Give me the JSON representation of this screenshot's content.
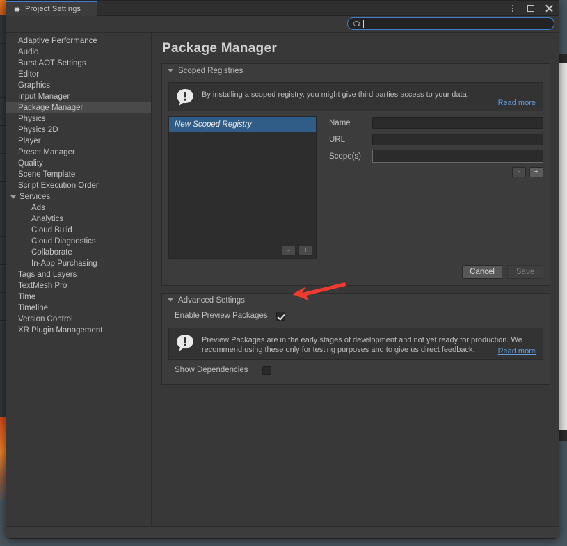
{
  "window": {
    "tab_label": "Project Settings",
    "tab_icon": "gear-icon",
    "controls": {
      "menu": "more-options-icon",
      "maximize": "maximize-icon",
      "close": "close-icon"
    },
    "accent_color": "#3f7fd0"
  },
  "search": {
    "value": "",
    "placeholder": "",
    "icon": "search-icon"
  },
  "sidebar": {
    "items": [
      {
        "label": "Adaptive Performance",
        "level": 0,
        "selected": false,
        "group": false
      },
      {
        "label": "Audio",
        "level": 0,
        "selected": false,
        "group": false
      },
      {
        "label": "Burst AOT Settings",
        "level": 0,
        "selected": false,
        "group": false
      },
      {
        "label": "Editor",
        "level": 0,
        "selected": false,
        "group": false
      },
      {
        "label": "Graphics",
        "level": 0,
        "selected": false,
        "group": false
      },
      {
        "label": "Input Manager",
        "level": 0,
        "selected": false,
        "group": false
      },
      {
        "label": "Package Manager",
        "level": 0,
        "selected": true,
        "group": false
      },
      {
        "label": "Physics",
        "level": 0,
        "selected": false,
        "group": false
      },
      {
        "label": "Physics 2D",
        "level": 0,
        "selected": false,
        "group": false
      },
      {
        "label": "Player",
        "level": 0,
        "selected": false,
        "group": false
      },
      {
        "label": "Preset Manager",
        "level": 0,
        "selected": false,
        "group": false
      },
      {
        "label": "Quality",
        "level": 0,
        "selected": false,
        "group": false
      },
      {
        "label": "Scene Template",
        "level": 0,
        "selected": false,
        "group": false
      },
      {
        "label": "Script Execution Order",
        "level": 0,
        "selected": false,
        "group": false
      },
      {
        "label": "Services",
        "level": 0,
        "selected": false,
        "group": true,
        "expanded": true
      },
      {
        "label": "Ads",
        "level": 1,
        "selected": false,
        "group": false
      },
      {
        "label": "Analytics",
        "level": 1,
        "selected": false,
        "group": false
      },
      {
        "label": "Cloud Build",
        "level": 1,
        "selected": false,
        "group": false
      },
      {
        "label": "Cloud Diagnostics",
        "level": 1,
        "selected": false,
        "group": false
      },
      {
        "label": "Collaborate",
        "level": 1,
        "selected": false,
        "group": false
      },
      {
        "label": "In-App Purchasing",
        "level": 1,
        "selected": false,
        "group": false
      },
      {
        "label": "Tags and Layers",
        "level": 0,
        "selected": false,
        "group": false
      },
      {
        "label": "TextMesh Pro",
        "level": 0,
        "selected": false,
        "group": false
      },
      {
        "label": "Time",
        "level": 0,
        "selected": false,
        "group": false
      },
      {
        "label": "Timeline",
        "level": 0,
        "selected": false,
        "group": false
      },
      {
        "label": "Version Control",
        "level": 0,
        "selected": false,
        "group": false
      },
      {
        "label": "XR Plugin Management",
        "level": 0,
        "selected": false,
        "group": false
      }
    ]
  },
  "main": {
    "title": "Package Manager",
    "scoped_registries": {
      "header": "Scoped Registries",
      "expanded": true,
      "notice": {
        "icon": "info-bubble-icon",
        "text": "By installing a scoped registry, you might give third parties access to your data.",
        "link": "Read more"
      },
      "registry_list": {
        "items": [
          {
            "label": "New Scoped Registry",
            "selected": true,
            "italic": true
          }
        ],
        "remove_button": "-",
        "add_button": "+"
      },
      "fields": [
        {
          "label": "Name",
          "value": "",
          "focused": false
        },
        {
          "label": "URL",
          "value": "",
          "focused": false
        },
        {
          "label": "Scope(s)",
          "value": "",
          "focused": true
        }
      ],
      "scope_buttons": {
        "remove": "-",
        "add": "+"
      },
      "footer": {
        "cancel": "Cancel",
        "save": "Save",
        "save_disabled": true
      }
    },
    "advanced_settings": {
      "header": "Advanced Settings",
      "expanded": true,
      "enable_preview": {
        "label": "Enable Preview Packages",
        "checked": true
      },
      "notice": {
        "icon": "info-bubble-icon",
        "text": "Preview Packages are in the early stages of development and not yet ready for production. We recommend using these only for testing purposes and to give us direct feedback.",
        "link": "Read more"
      },
      "show_dependencies": {
        "label": "Show Dependencies",
        "checked": false
      }
    }
  },
  "annotation": {
    "type": "arrow",
    "color": "#f03a2e",
    "points_to": "enable-preview-packages-checkbox"
  }
}
